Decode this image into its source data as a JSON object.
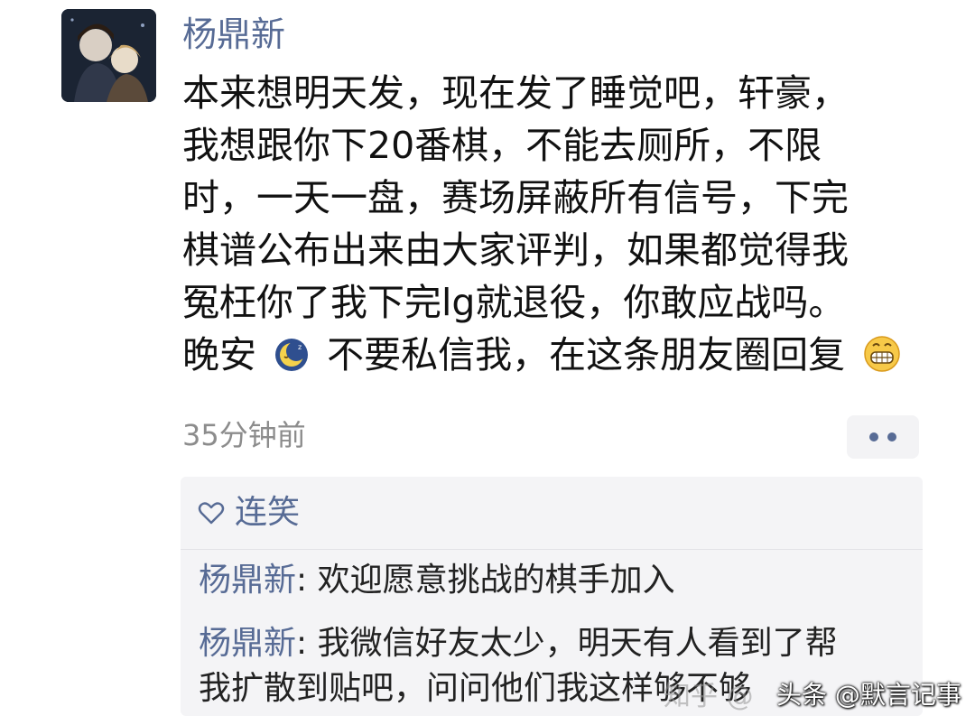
{
  "post": {
    "author": "杨鼎新",
    "lines": [
      "本来想明天发，现在发了睡觉吧，轩豪，",
      "我想跟你下20番棋，不能去厕所，不限",
      "时，一天一盘，赛场屏蔽所有信号，下完",
      "棋谱公布出来由大家评判，如果都觉得我",
      "冤枉你了我下完lg就退役，你敢应战吗。"
    ],
    "last_line_part1": "晚安",
    "last_line_part2": "不要私信我，在这条朋友圈回复",
    "emoji_1": "moon-sleep-emoji",
    "emoji_2": "grin-emoji",
    "timestamp": "35分钟前"
  },
  "interactions": {
    "likes": "连笑",
    "comments": [
      {
        "author": "杨鼎新",
        "separator": ": ",
        "lines": [
          "欢迎愿意挑战的棋手加入"
        ]
      },
      {
        "author": "杨鼎新",
        "separator": ": ",
        "lines": [
          "我微信好友太少，明天有人看到了帮",
          "我扩散到贴吧，问问他们我这样够不够"
        ]
      }
    ]
  },
  "watermarks": {
    "zhihu": "知乎 @",
    "toutiao": "头条 @默言记事"
  },
  "colors": {
    "link_blue": "#576b95",
    "text": "#111111",
    "meta_gray": "#8c8c8c",
    "comment_bg": "#f4f4f6"
  }
}
